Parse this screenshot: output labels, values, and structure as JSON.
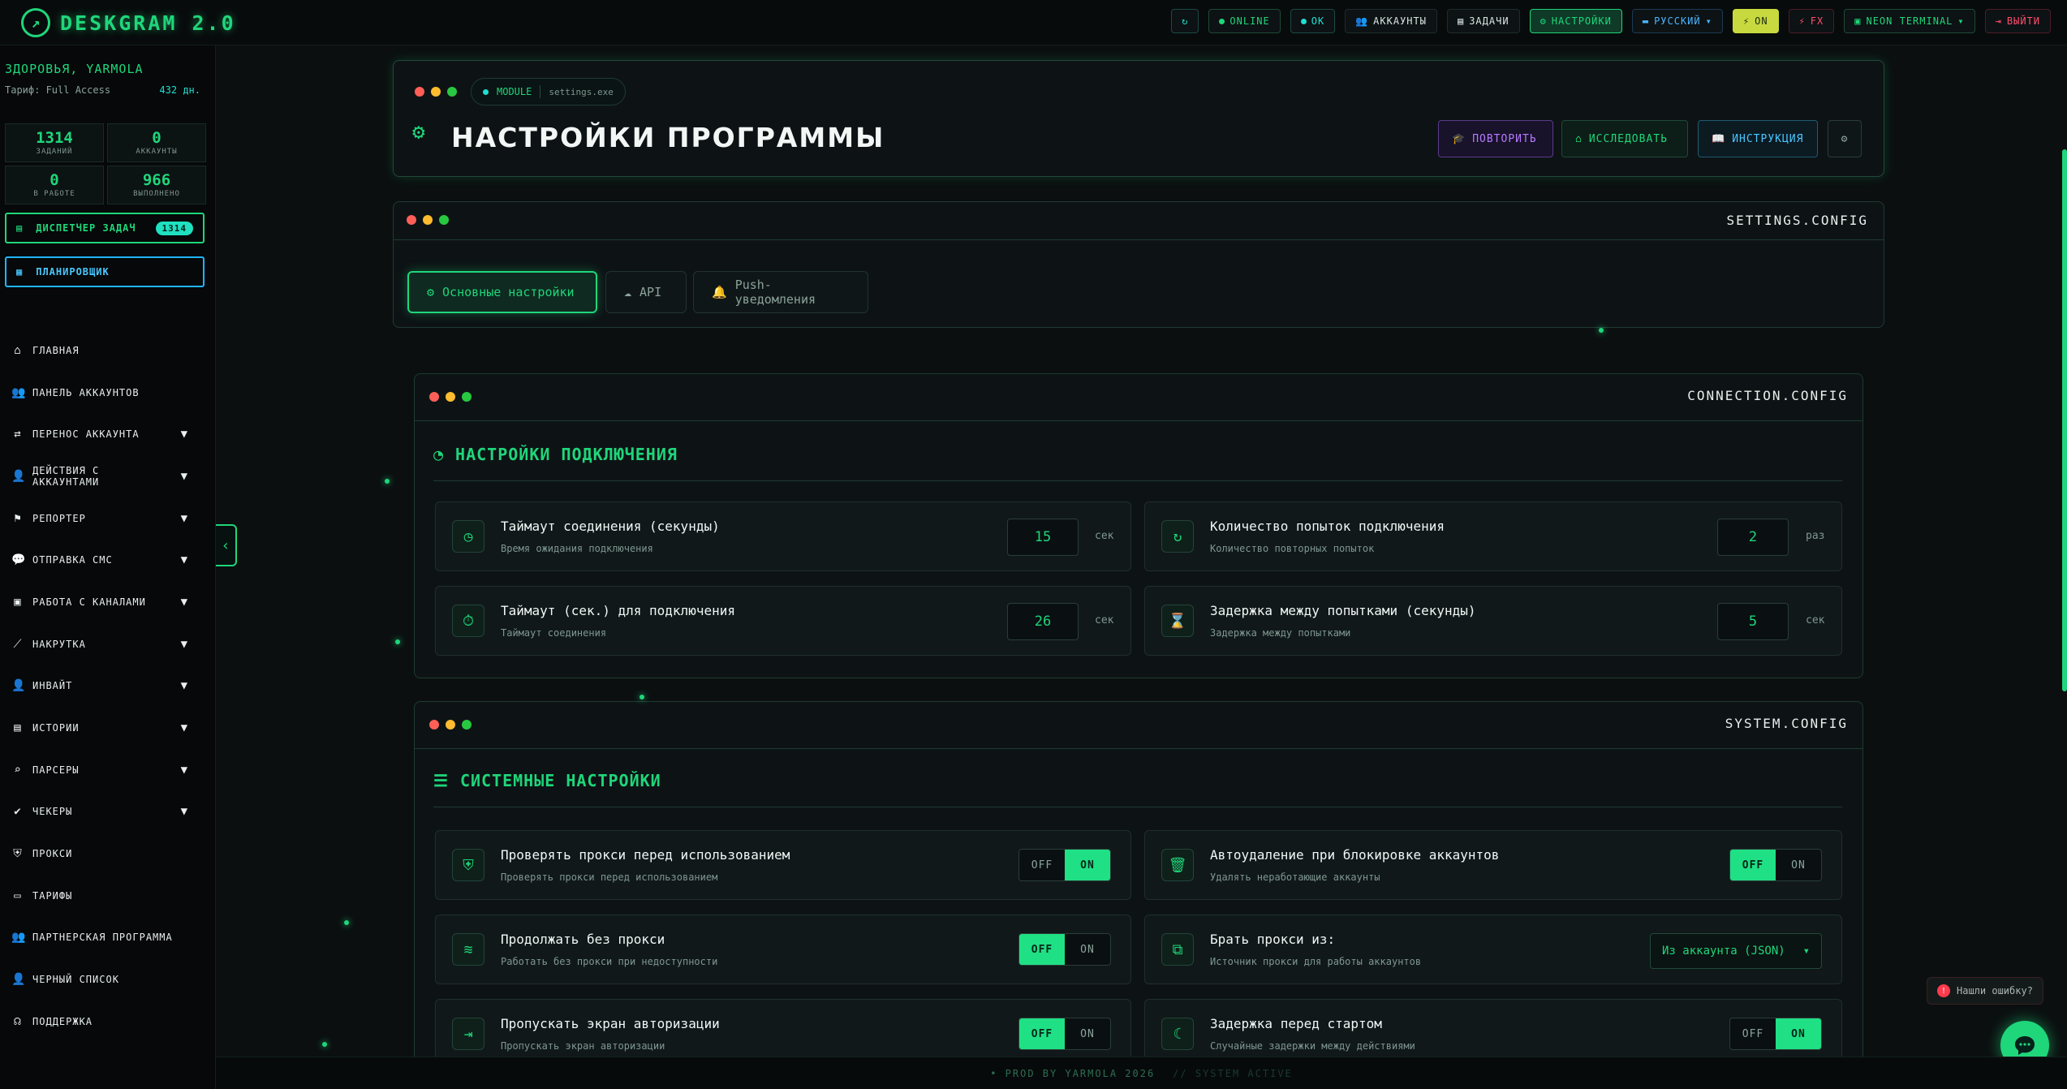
{
  "app": {
    "title": "DESKGRAM 2.0"
  },
  "topbar": {
    "refresh_icon": "refresh-icon",
    "online": "ONLINE",
    "ok": "OK",
    "accounts": "АККАУНТЫ",
    "tasks": "ЗАДАЧИ",
    "settings": "НАСТРОЙКИ",
    "language": "РУССКИЙ",
    "on": "ON",
    "fx": "FX",
    "theme": "NEON TERMINAL",
    "logout": "ВЫЙТИ"
  },
  "sidebar": {
    "greeting": "ЗДОРОВЬЯ, YARMOLA",
    "tariff": "Тариф: Full Access",
    "days": "432 дн.",
    "stats": [
      {
        "value": "1314",
        "label": "ЗАДАНИЙ"
      },
      {
        "value": "0",
        "label": "АККАУНТЫ"
      },
      {
        "value": "0",
        "label": "В РАБОТЕ"
      },
      {
        "value": "966",
        "label": "ВЫПОЛНЕНО"
      }
    ],
    "dispatcher": "ДИСПЕТЧЕР ЗАДАЧ",
    "dispatcher_badge": "1314",
    "scheduler": "ПЛАНИРОВЩИК",
    "items": [
      {
        "label": "ГЛАВНАЯ",
        "icon": "home-icon",
        "glyph": "⌂",
        "chev": false
      },
      {
        "label": "ПАНЕЛЬ АККАУНТОВ",
        "icon": "users-icon",
        "glyph": "👥",
        "chev": false
      },
      {
        "label": "ПЕРЕНОС АККАУНТА",
        "icon": "transfer-icon",
        "glyph": "⇄",
        "chev": true
      },
      {
        "label": "ДЕЙСТВИЯ С АККАУНТАМИ",
        "icon": "user-cog-icon",
        "glyph": "👤",
        "chev": true
      },
      {
        "label": "РЕПОРТЕР",
        "icon": "flag-icon",
        "glyph": "⚑",
        "chev": true
      },
      {
        "label": "ОТПРАВКА СМС",
        "icon": "chat-icon",
        "glyph": "💬",
        "chev": true
      },
      {
        "label": "РАБОТА С КАНАЛАМИ",
        "icon": "briefcase-icon",
        "glyph": "▣",
        "chev": true
      },
      {
        "label": "НАКРУТКА",
        "icon": "chart-line-icon",
        "glyph": "⟋",
        "chev": true
      },
      {
        "label": "ИНВАЙТ",
        "icon": "user-plus-icon",
        "glyph": "👤",
        "chev": true
      },
      {
        "label": "ИСТОРИИ",
        "icon": "stories-icon",
        "glyph": "▤",
        "chev": true
      },
      {
        "label": "ПАРСЕРЫ",
        "icon": "search-icon",
        "glyph": "⌕",
        "chev": true
      },
      {
        "label": "ЧЕКЕРЫ",
        "icon": "check-circle-icon",
        "glyph": "✔",
        "chev": true
      },
      {
        "label": "ПРОКСИ",
        "icon": "shield-icon",
        "glyph": "⛨",
        "chev": false
      },
      {
        "label": "ТАРИФЫ",
        "icon": "card-icon",
        "glyph": "▭",
        "chev": false
      },
      {
        "label": "ПАРТНЕРСКАЯ ПРОГРАММА",
        "icon": "partners-icon",
        "glyph": "👥",
        "chev": false
      },
      {
        "label": "ЧЕРНЫЙ СПИСОК",
        "icon": "user-block-icon",
        "glyph": "👤",
        "chev": false
      },
      {
        "label": "ПОДДЕРЖКА",
        "icon": "headset-icon",
        "glyph": "☊",
        "chev": false
      }
    ]
  },
  "header": {
    "module": "MODULE",
    "module_file": "settings.exe",
    "title": "НАСТРОЙКИ ПРОГРАММЫ",
    "btn_repeat": "ПОВТОРИТЬ",
    "btn_explore": "ИССЛЕДОВАТЬ",
    "btn_guide": "ИНСТРУКЦИЯ"
  },
  "settings_panel": {
    "config": "SETTINGS.CONFIG",
    "tabs": [
      "Основные настройки",
      "API",
      "Push-уведомления"
    ]
  },
  "connection": {
    "config": "CONNECTION.CONFIG",
    "title": "НАСТРОЙКИ ПОДКЛЮЧЕНИЯ",
    "rows": [
      {
        "title": "Таймаут соединения (секунды)",
        "desc": "Время ожидания подключения",
        "value": "15",
        "unit": "сек"
      },
      {
        "title": "Количество попыток подключения",
        "desc": "Количество повторных попыток",
        "value": "2",
        "unit": "раз"
      },
      {
        "title": "Таймаут (сек.) для подключения",
        "desc": "Таймаут соединения",
        "value": "26",
        "unit": "сек"
      },
      {
        "title": "Задержка между попытками (секунды)",
        "desc": "Задержка между попытками",
        "value": "5",
        "unit": "сек"
      }
    ]
  },
  "system": {
    "config": "SYSTEM.CONFIG",
    "title": "СИСТЕМНЫЕ НАСТРОЙКИ",
    "off": "OFF",
    "on": "ON",
    "rows": [
      {
        "title": "Проверять прокси перед использованием",
        "desc": "Проверять прокси перед использованием",
        "state": "ON"
      },
      {
        "title": "Автоудаление при блокировке аккаунтов",
        "desc": "Удалять неработающие аккаунты",
        "state": "OFF"
      },
      {
        "title": "Продолжать без прокси",
        "desc": "Работать без прокси при недоступности",
        "state": "OFF"
      },
      {
        "title": "Брать прокси из:",
        "desc": "Источник прокси для работы аккаунтов",
        "select": "Из аккаунта (JSON)"
      },
      {
        "title": "Пропускать экран авторизации",
        "desc": "Пропускать экран авторизации",
        "state": "OFF"
      },
      {
        "title": "Задержка перед стартом",
        "desc": "Случайные задержки между действиями",
        "state": "ON"
      }
    ]
  },
  "footer": {
    "prod": "PROD BY YARMOLA 2026",
    "status": "// SYSTEM ACTIVE"
  },
  "bug_report": "Нашли ошибку?",
  "colors": {
    "accent": "#1fd67a",
    "teal": "#1fe0d0",
    "bg": "#0b0f10"
  }
}
